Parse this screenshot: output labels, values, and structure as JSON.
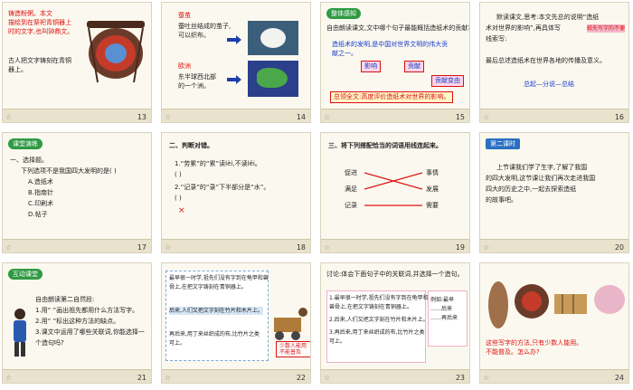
{
  "slides": [
    {
      "num": "13",
      "lines": [
        "铸造粉粥。本文",
        "描绘到在祭祀青铜器上",
        "时的文字,也叫钟鼎文。",
        "古人把文字铸刻在青铜",
        "器上。"
      ]
    },
    {
      "num": "14",
      "l1": "蚕茧",
      "l2": "蚕吐丝结成的茧子,",
      "l3": "可以织布。",
      "l4": "欧洲",
      "l5": "东半球西北部",
      "l6": "的一个洲。"
    },
    {
      "num": "15",
      "head": "整体感知",
      "q": "自由朗读课文,文中哪个句子最能概括造纸术的贡献?",
      "s1": "造纸术的发明,是中国对世界文明的伟大贡",
      "s2": "献之一。",
      "b1": "影响",
      "b2": "贡献",
      "b3": "贡献变由",
      "sum": "总领全文:高度评价造纸术对世界的影响。"
    },
    {
      "num": "16",
      "lines": [
        "默读课文,思考:本文先总的说明“造纸",
        "术对世界的影响”,再具体写",
        "纸先写字的不便",
        "线索写:",
        "",
        "最后总述造纸术在世界各地的传播及意义。",
        "总起—分说—总结"
      ]
    },
    {
      "num": "17",
      "head": "课堂演练",
      "l1": "一、选择题。",
      "l2": "下列选项不是我国四大发明的是(   )",
      "o1": "A.造纸术",
      "o2": "B.指南针",
      "o3": "C.印刷术",
      "o4": "D.帖子"
    },
    {
      "num": "18",
      "head": "二、判断对错。",
      "l1": "1.“劳累”的“累”读lèi,不读lěi。",
      "l2": "(  )",
      "l3": "2.“记录”的“录”下半部分是“水”。",
      "l4": "(  )",
      "x": "×"
    },
    {
      "num": "19",
      "head": "三、将下列搭配恰当的词语用线连起来。",
      "a": [
        "促进",
        "满足",
        "记录"
      ],
      "b": [
        "事情",
        "发展",
        "需要"
      ]
    },
    {
      "num": "20",
      "head": "第二课时",
      "lines": [
        "上节课我们学了生字,了解了我国",
        "的四大发明,这节课让我们再次走进我国",
        "四大的历史之中,一起去探索造纸",
        "的故事吧。"
      ]
    },
    {
      "num": "21",
      "head": "互动课堂",
      "lines": [
        "自由朗读第二自然段:",
        "1.用“ ”画出祖先都用什么方法写字。",
        "2.用“ ”标出这种方法的缺点。",
        "3.课文中运用了哪些关联词,你能选择一",
        "个造句吗?"
      ]
    },
    {
      "num": "22",
      "lines": [
        "最早很一时学,祖先们没有字到在龟甲和兽",
        "骨上,在把文字铸刻在青铜器上。",
        "后来,人们又把文字刻在竹片和木片上。",
        "再后来,用丁来丝织成的布,比竹片之类",
        "可上。"
      ],
      "tag": "少数人能用不能普及"
    },
    {
      "num": "23",
      "intro": "讨论:体会下面句子中的关联词,并选择一个造句。",
      "lines": [
        "1.最早很一时学,祖先们没有字到在龟甲和",
        "兽骨上,在把文字铸刻在青铜器上。",
        "2.后来,人们又把文字刻在竹片和木片上。",
        "3.再后来,用丁来丝织成的布,比竹片之类",
        "可上。"
      ],
      "side": [
        "例如:最早",
        "……后来",
        "……再后来"
      ]
    },
    {
      "num": "24",
      "c1": "这些写字的方法,只有少数人能用。",
      "c2": "不能普及。怎么办?"
    }
  ]
}
